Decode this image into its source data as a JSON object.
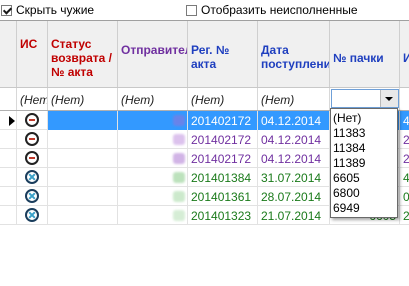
{
  "filters_bar": {
    "hide_others_label": "Скрыть чужие",
    "hide_others_checked": true,
    "show_unfulfilled_label": "Отобразить неисполненные",
    "show_unfulfilled_checked": false
  },
  "grid": {
    "columns": [
      {
        "key": "is",
        "label": "ИС",
        "color": "#c00000"
      },
      {
        "key": "status",
        "label": "Статус возврата / № акта",
        "color": "#c00000"
      },
      {
        "key": "sender",
        "label": "Отправител",
        "color": "#7030a0"
      },
      {
        "key": "reg_no",
        "label": "Рег. № акта",
        "color": "#1f3fbf"
      },
      {
        "key": "date",
        "label": "Дата поступления",
        "color": "#1f3fbf"
      },
      {
        "key": "pack_no",
        "label": "№ пачки",
        "color": "#1f3fbf"
      },
      {
        "key": "extra",
        "label": "И",
        "color": "#1f3fbf"
      }
    ],
    "filter_values": {
      "is": "(Нет)",
      "status": "(Нет)",
      "sender": "(Нет)",
      "reg_no": "(Нет)",
      "date": "(Нет)",
      "pack_no": "",
      "extra": ""
    },
    "rows": [
      {
        "icon": "minus",
        "reg_no": "201402172",
        "date": "04.12.2014",
        "pack_no": "",
        "extra": "4",
        "color": "#1f3fbf",
        "selected": true
      },
      {
        "icon": "minus",
        "reg_no": "201402172",
        "date": "04.12.2014",
        "pack_no": "",
        "extra": "2",
        "color": "#7030a0",
        "selected": false
      },
      {
        "icon": "minus",
        "reg_no": "201402172",
        "date": "04.12.2014",
        "pack_no": "",
        "extra": "2",
        "color": "#7030a0",
        "selected": false
      },
      {
        "icon": "cross",
        "reg_no": "201401384",
        "date": "31.07.2014",
        "pack_no": "",
        "extra": "4",
        "color": "#1a7a1a",
        "selected": false
      },
      {
        "icon": "cross",
        "reg_no": "201401361",
        "date": "28.07.2014",
        "pack_no": "",
        "extra": "0",
        "color": "#1a7a1a",
        "selected": false
      },
      {
        "icon": "cross",
        "reg_no": "201401323",
        "date": "21.07.2014",
        "pack_no": "6605",
        "extra": "2",
        "color": "#1a7a1a",
        "selected": false
      }
    ]
  },
  "pack_filter_dropdown": {
    "options": [
      "(Нет)",
      "11383",
      "11384",
      "11389",
      "6605",
      "6800",
      "6949"
    ]
  }
}
